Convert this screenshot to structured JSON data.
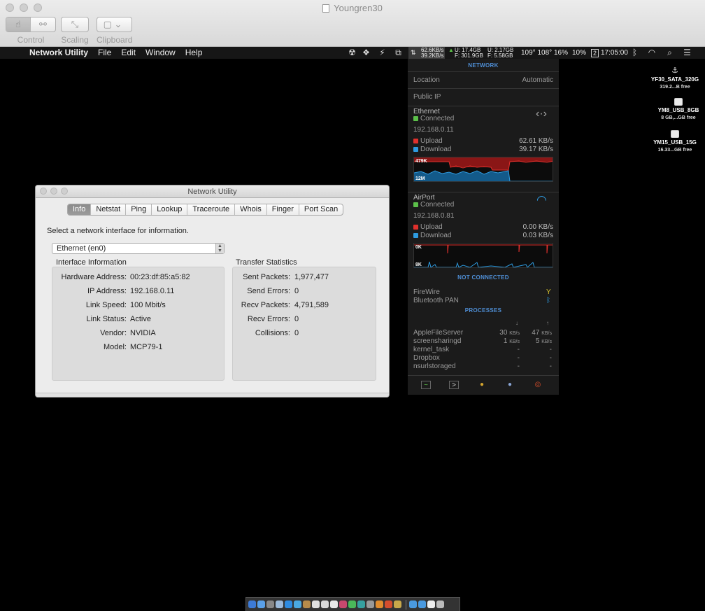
{
  "viewer": {
    "title": "Youngren30",
    "tools": [
      {
        "label": "Control"
      },
      {
        "label": "Scaling"
      },
      {
        "label": "Clipboard"
      }
    ]
  },
  "menubar": {
    "app_name": "Network Utility",
    "menus": [
      "File",
      "Edit",
      "Window",
      "Help"
    ],
    "net_up": "62.6KB/s",
    "net_down": "39.2KB/s",
    "disk_u1": "U:  17.4GB",
    "disk_f1": "F: 301.9GB",
    "disk_u2": "U:  2.17GB",
    "disk_f2": "F:  5.58GB",
    "temps": "109° 108°",
    "cpu": "16%",
    "mem": "10%",
    "space": "2",
    "clock": "17:05:00"
  },
  "network_utility": {
    "title": "Network Utility",
    "tabs": [
      "Info",
      "Netstat",
      "Ping",
      "Lookup",
      "Traceroute",
      "Whois",
      "Finger",
      "Port Scan"
    ],
    "active_tab": "Info",
    "prompt": "Select a network interface for information.",
    "interface_selected": "Ethernet (en0)",
    "interface_info": {
      "heading": "Interface Information",
      "rows": [
        {
          "key": "Hardware Address:",
          "value": "00:23:df:85:a5:82"
        },
        {
          "key": "IP Address:",
          "value": "192.168.0.11"
        },
        {
          "key": "Link Speed:",
          "value": "100 Mbit/s"
        },
        {
          "key": "Link Status:",
          "value": "Active"
        },
        {
          "key": "Vendor:",
          "value": "NVIDIA"
        },
        {
          "key": "Model:",
          "value": "MCP79-1"
        }
      ]
    },
    "transfer_stats": {
      "heading": "Transfer Statistics",
      "rows": [
        {
          "key": "Sent Packets:",
          "value": "1,977,477"
        },
        {
          "key": "Send Errors:",
          "value": "0"
        },
        {
          "key": "Recv Packets:",
          "value": "4,791,589"
        },
        {
          "key": "Recv Errors:",
          "value": "0"
        },
        {
          "key": "Collisions:",
          "value": "0"
        }
      ]
    }
  },
  "net_panel": {
    "header": "NETWORK",
    "location_label": "Location",
    "location_value": "Automatic",
    "public_ip_label": "Public IP",
    "ethernet": {
      "name": "Ethernet",
      "status": "Connected",
      "ip": "192.168.0.11",
      "upload_label": "Upload",
      "upload_value": "62.61 KB/s",
      "download_label": "Download",
      "download_value": "39.17 KB/s",
      "graph_top": "479K",
      "graph_bottom": "12M"
    },
    "airport": {
      "name": "AirPort",
      "status": "Connected",
      "ip": "192.168.0.81",
      "upload_label": "Upload",
      "upload_value": "0.00 KB/s",
      "download_label": "Download",
      "download_value": "0.03 KB/s",
      "graph_top": "0K",
      "graph_bottom": "8K"
    },
    "not_connected_header": "NOT CONNECTED",
    "not_connected": [
      "FireWire",
      "Bluetooth PAN"
    ],
    "processes_header": "PROCESSES",
    "processes": [
      {
        "name": "AppleFileServer",
        "down": "30",
        "down_unit": "KB/s",
        "up": "47",
        "up_unit": "KB/s"
      },
      {
        "name": "screensharingd",
        "down": "1",
        "down_unit": "KB/s",
        "up": "5",
        "up_unit": "KB/s"
      },
      {
        "name": "kernel_task",
        "down": "-",
        "down_unit": "",
        "up": "-",
        "up_unit": ""
      },
      {
        "name": "Dropbox",
        "down": "-",
        "down_unit": "",
        "up": "-",
        "up_unit": ""
      },
      {
        "name": "nsurlstoraged",
        "down": "-",
        "down_unit": "",
        "up": "-",
        "up_unit": ""
      }
    ],
    "colors": {
      "upload": "#e0302c",
      "download": "#2e9be0",
      "connected": "#5cc04a",
      "header": "#4f8fd6"
    }
  },
  "drives": [
    {
      "name": "YF30_SATA_320G",
      "free": "319.2...B free"
    },
    {
      "name": "YM8_USB_8GB",
      "free": "8 GB,...GB free"
    },
    {
      "name": "YM15_USB_15G",
      "free": "16.33...GB free"
    }
  ]
}
